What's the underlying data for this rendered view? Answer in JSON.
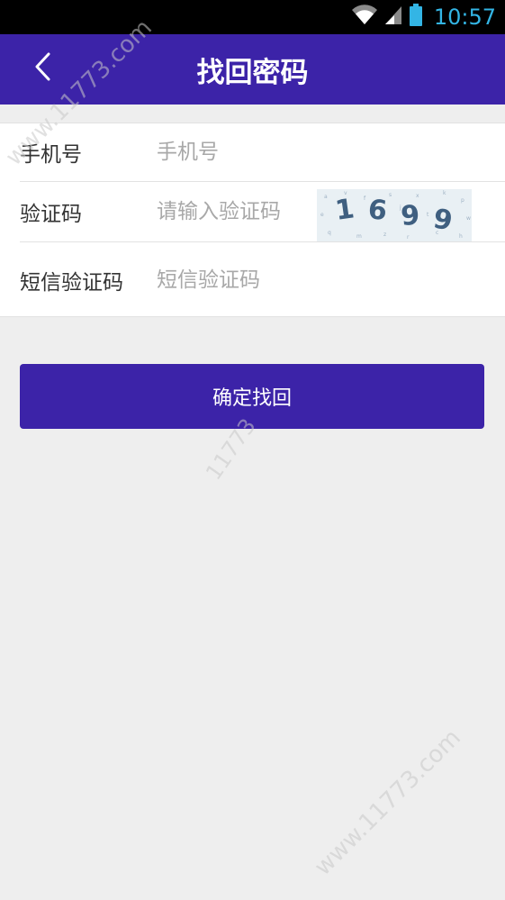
{
  "status_bar": {
    "time": "10:57",
    "icons": [
      "wifi-icon",
      "signal-icon",
      "battery-icon"
    ]
  },
  "header": {
    "title": "找回密码",
    "back_icon": "chevron-left-icon"
  },
  "form": {
    "phone": {
      "label": "手机号",
      "placeholder": "手机号",
      "value": ""
    },
    "captcha": {
      "label": "验证码",
      "placeholder": "请输入验证码",
      "value": "",
      "image_text": "1699"
    },
    "sms": {
      "label": "短信验证码",
      "placeholder": "短信验证码",
      "value": ""
    }
  },
  "submit": {
    "label": "确定找回"
  },
  "watermark": {
    "text": "www.11773.com",
    "short": "11773"
  },
  "colors": {
    "primary": "#3c23a8",
    "status_bar": "#000000",
    "status_time": "#33b5e5",
    "background": "#eeeeee",
    "placeholder": "#a8a8a8"
  }
}
